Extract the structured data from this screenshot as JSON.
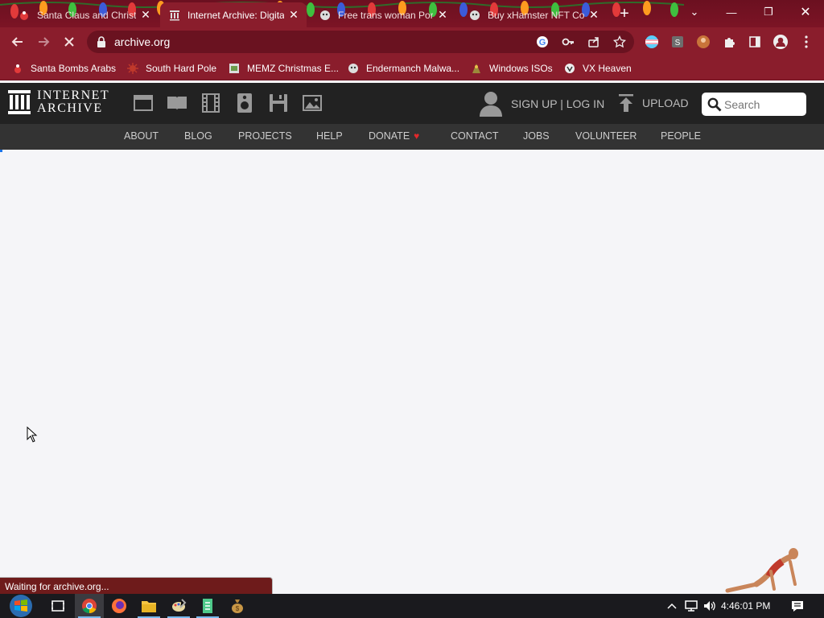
{
  "browser": {
    "tabs": [
      {
        "title": "Santa Claus and Christ",
        "icon": "santa-icon"
      },
      {
        "title": "Internet Archive: Digita",
        "icon": "archive-icon"
      },
      {
        "title": "Free trans woman Porn",
        "icon": "xhamster-icon"
      },
      {
        "title": "Buy xHamster NFT Co",
        "icon": "xhamster-icon"
      }
    ],
    "url": "archive.org",
    "bookmarks": [
      "Santa Bombs Arabs",
      "South Hard Pole",
      "MEMZ Christmas E...",
      "Endermanch Malwa...",
      "Windows ISOs",
      "VX Heaven"
    ],
    "status": "Waiting for archive.org..."
  },
  "archive": {
    "logo_line1": "INTERNET",
    "logo_line2": "ARCHIVE",
    "signup": "SIGN UP | LOG IN",
    "upload": "UPLOAD",
    "search_placeholder": "Search",
    "nav": [
      "ABOUT",
      "BLOG",
      "PROJECTS",
      "HELP",
      "DONATE",
      "CONTACT",
      "JOBS",
      "VOLUNTEER",
      "PEOPLE"
    ],
    "colors": {
      "header": "#222222",
      "nav": "#333333",
      "heart": "#e2282b"
    }
  },
  "taskbar": {
    "time": "4:46:01 PM"
  },
  "colors": {
    "tabstrip": "#7c1425",
    "toolbar": "#8a1d2c",
    "page_bg": "#f5f5f8"
  }
}
